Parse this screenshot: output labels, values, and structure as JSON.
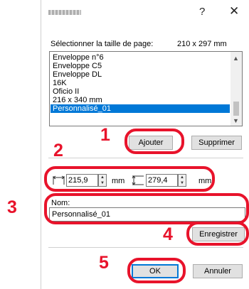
{
  "dialog": {
    "title_blurred": "",
    "help_label": "?",
    "close_label": "✕",
    "page_size_label": "Sélectionner la taille de page:",
    "page_size_value": "210 x 297 mm"
  },
  "list": {
    "items": [
      {
        "label": "Enveloppe n°6",
        "selected": false
      },
      {
        "label": "Enveloppe C5",
        "selected": false
      },
      {
        "label": "Enveloppe DL",
        "selected": false
      },
      {
        "label": "16K",
        "selected": false
      },
      {
        "label": "Oficio II",
        "selected": false
      },
      {
        "label": "216 x 340 mm",
        "selected": false
      },
      {
        "label": "Personnalisé_01",
        "selected": true
      }
    ]
  },
  "buttons": {
    "add": "Ajouter",
    "delete": "Supprimer",
    "save": "Enregistrer",
    "ok": "OK",
    "cancel": "Annuler"
  },
  "dimensions": {
    "width_value": "215,9",
    "height_value": "279,4",
    "unit": "mm"
  },
  "name": {
    "label": "Nom:",
    "value": "Personnalisé_01"
  },
  "steps": {
    "s1": "1",
    "s2": "2",
    "s3": "3",
    "s4": "4",
    "s5": "5"
  },
  "colors": {
    "annotation": "#e8132b",
    "selection": "#0078d7"
  }
}
